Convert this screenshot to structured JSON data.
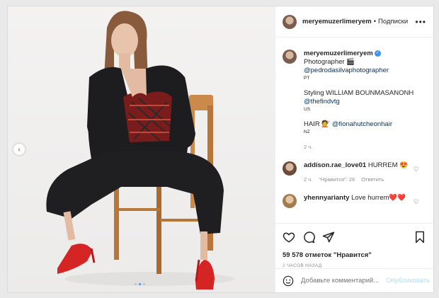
{
  "post": {
    "username": "meryemuzerlimeryem",
    "follow_sep": "•",
    "follow_label": "Подписки",
    "more": "•••"
  },
  "caption": {
    "username": "meryemuzerlimeryem",
    "verified": "✓",
    "line1": "Photographer 🎬",
    "line2": "@pedrodasilvaphotographer",
    "line3": "PT",
    "line4": "Styling WILLIAM BOUNMASANONH",
    "line5": "@thefindvtg",
    "line6": "US",
    "line7_prefix": "HAIR 💇",
    "line7_link": "@fionahutcheonhair",
    "line8": "NZ",
    "time": "2 ч."
  },
  "comments": [
    {
      "username": "addison.rae_love01",
      "text": "HURREM 😍",
      "time": "2 ч.",
      "likes": "\"Нравится\": 26",
      "reply": "Ответить"
    },
    {
      "username": "yhennyarianty",
      "text": "Love hurrem❤️❤️"
    }
  ],
  "stats": {
    "likes": "59 578 отметок \"Нравится\"",
    "ago": "2 ЧАСОВ НАЗАД"
  },
  "add_comment": {
    "placeholder": "Добавьте комментарий...",
    "publish": "Опубликовать"
  },
  "nav": {
    "prev": "‹"
  },
  "icons": [
    "heart-icon",
    "comment-icon",
    "share-icon",
    "bookmark-icon",
    "emoji-icon",
    "more-icon"
  ],
  "colors": {
    "link": "#00376b",
    "verified": "#3897f0",
    "publish": "#b2dffc",
    "dot_active": "#4a8ef0"
  }
}
